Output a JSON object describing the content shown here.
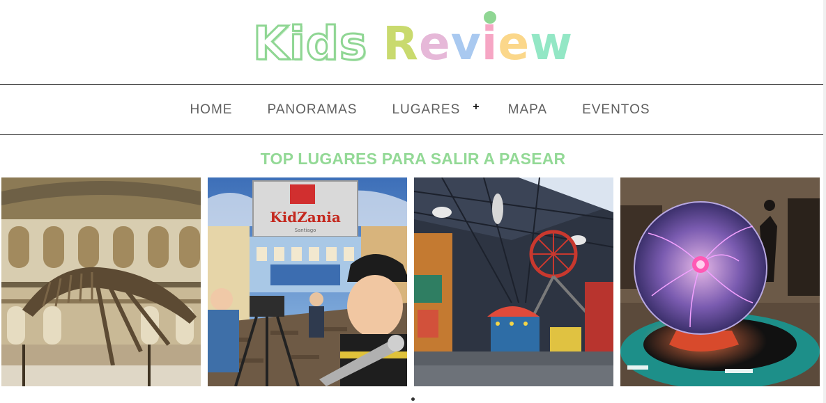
{
  "logo": {
    "word1": [
      "K",
      "i",
      "d",
      "s"
    ],
    "word2": [
      "R",
      "e",
      "v",
      "i",
      "e",
      "w"
    ]
  },
  "nav": {
    "items": [
      {
        "label": "HOME"
      },
      {
        "label": "PANORAMAS"
      },
      {
        "label": "LUGARES",
        "has_submenu": true,
        "submenu_indicator": "+"
      },
      {
        "label": "MAPA"
      },
      {
        "label": "EVENTOS"
      }
    ]
  },
  "section": {
    "title": "TOP LUGARES PARA SALIR A PASEAR"
  },
  "gallery": {
    "kidzania_sign": "KidZania",
    "kidzania_sub": "Santiago"
  },
  "colors": {
    "accent_green": "#93d996",
    "nav_text": "#5f5f5f"
  }
}
